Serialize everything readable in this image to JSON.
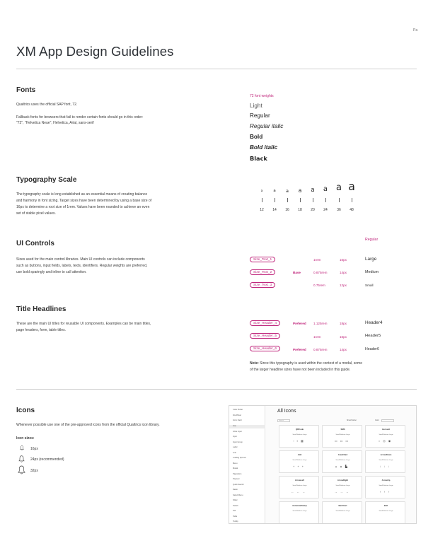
{
  "page": {
    "header_label": "Pa",
    "title": "XM App Design Guidelines"
  },
  "fonts": {
    "heading": "Fonts",
    "p1": "Qualtrics uses the official SAP font, 72.",
    "p2": "Fallback fonts for browsers that fail to render certain fonts should go in this order:",
    "p3": "\"72\", \"Helvetica Neue\", Helvetica, Arial, sans-serif",
    "weights_label": "72 font weights",
    "weights": [
      "Light",
      "Regular",
      "Regular italic",
      "Bold",
      "Bold italic",
      "Black"
    ]
  },
  "typography": {
    "heading": "Typography Scale",
    "p1": "The typography scale is long established as an essential means of creating balance",
    "p2": "and harmony in font sizing. Target sizes have been determined by using a base size of",
    "p3": "16px to determine a root size of 1rem. Values have been rounded to achieve an even",
    "p4": "set of stable pixel values.",
    "glyph": "a",
    "scale": [
      "12",
      "14",
      "16",
      "18",
      "20",
      "24",
      "36",
      "48"
    ]
  },
  "ui_controls": {
    "heading": "UI Controls",
    "p1": "Sizes used for the main control libraries. Main UI controls can include components",
    "p2": "such as buttons, input fields, labels, texts, identifiers. Regular weights are preferred,",
    "p3": "use bold sparingly and inline to call attention.",
    "column_label": "Regular",
    "rows": [
      {
        "chip": "Size_Text_1",
        "tag": "",
        "rem": "1rem",
        "px": "16px",
        "sample": "Large"
      },
      {
        "chip": "Size_Text_2",
        "tag": "Base",
        "rem": "0.875rem",
        "px": "14px",
        "sample": "Medium"
      },
      {
        "chip": "Size_Text_3",
        "tag": "",
        "rem": "0.75rem",
        "px": "12px",
        "sample": "Small"
      }
    ]
  },
  "title_headlines": {
    "heading": "Title Headlines",
    "p1": "These are the main UI titles for reusable UI components. Examples can be main titles,",
    "p2": "page headers, form, table titles.",
    "rows": [
      {
        "chip": "Size_Header_4",
        "tag": "Prefered",
        "rem": "1.125rem",
        "px": "18px",
        "sample": "Header4"
      },
      {
        "chip": "Size_Header_5",
        "tag": "",
        "rem": "1rem",
        "px": "16px",
        "sample": "Header5"
      },
      {
        "chip": "Size_Header_6",
        "tag": "Prefered",
        "rem": "0.875rem",
        "px": "14px",
        "sample": "Header6"
      }
    ],
    "note_label": "Note:",
    "note_1": " Since this typography is used within the context of a modal, some",
    "note_2": "of the larger headline sizes have not been included in this guide."
  },
  "icons": {
    "heading": "Icons",
    "p1": "Whenever possible use one of the pre-approved icons from the official Qualtrics icon library.",
    "sizes_label": "Icon sizes:",
    "sizes": [
      "16px",
      "24px (recommended)",
      "32px"
    ],
    "icon_name": "bell-icon"
  },
  "thumbnail": {
    "title": "All Icons",
    "search_placeholder": "Search",
    "toolbar_1": "Show Border",
    "toolbar_2": "Color",
    "sidebar": [
      "Color Picker",
      "File Picker",
      "Form Field",
      "Icon",
      "Inline Input",
      "Input",
      "Input Group",
      "Label",
      "Link",
      "Loading Spinner",
      "Menu",
      "Modal",
      "Pagination",
      "Popover",
      "Quick Search",
      "Radio",
      "Select Menu",
      "Slider",
      "Switch",
      "Tab",
      "Table",
      "Tooltip"
    ],
    "size_options": "Small  Medium  Large",
    "cards": [
      "QRCode",
      "SMS",
      "Account",
      "Add",
      "AreaChart",
      "ArrowDown",
      "ArrowLeft",
      "ArrowRight",
      "ArrowUp",
      "AutomateSetup",
      "BarChart",
      "Bell"
    ]
  }
}
